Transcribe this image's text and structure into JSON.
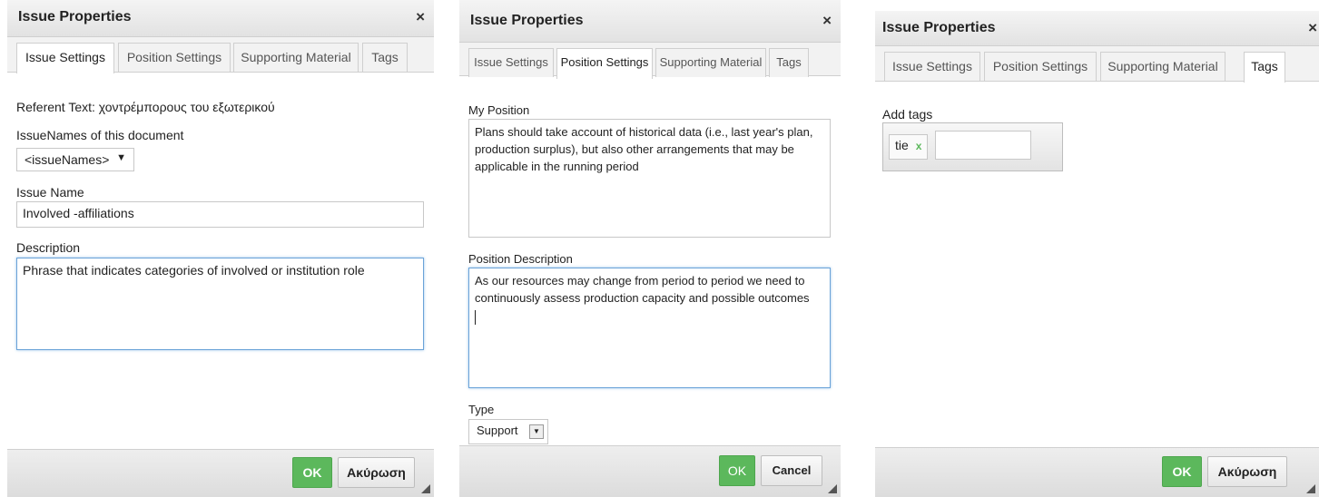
{
  "dialogs": [
    {
      "title": "Issue Properties",
      "close_icon": "×",
      "tabs": [
        "Issue Settings",
        "Position Settings",
        "Supporting Material",
        "Tags"
      ],
      "active_tab": "Issue Settings",
      "referent_text": "Referent Text: χοντρέμπορους του εξωτερικού",
      "issue_names_label": "IssueNames of this document",
      "issue_names_select": "<issueNames>",
      "issue_name_label": "Issue Name",
      "issue_name_value": "Involved -affiliations",
      "description_label": "Description",
      "description_value": "Phrase that indicates categories of involved or institution role",
      "ok_label": "OK",
      "cancel_label": "Ακύρωση"
    },
    {
      "title": "Issue Properties",
      "close_icon": "×",
      "tabs": [
        "Issue Settings",
        "Position Settings",
        "Supporting Material",
        "Tags"
      ],
      "active_tab": "Position Settings",
      "my_position_label": "My Position",
      "my_position_value": "Plans should take account of historical data (i.e., last year's plan, production surplus), but also other arrangements that may be applicable in the running period",
      "position_description_label": "Position Description",
      "position_description_value": "As our resources may change from period to period we need to continuously assess production capacity and possible outcomes",
      "type_label": "Type",
      "type_value": "Support",
      "ok_label": "OK",
      "cancel_label": "Cancel"
    },
    {
      "title": "Issue Properties",
      "close_icon": "×",
      "tabs": [
        "Issue Settings",
        "Position Settings",
        "Supporting Material",
        "Tags"
      ],
      "active_tab": "Tags",
      "add_tags_label": "Add tags",
      "tags": [
        {
          "label": "tie",
          "remove": "x"
        }
      ],
      "ok_label": "OK",
      "cancel_label": "Ακύρωση"
    }
  ],
  "colors": {
    "ok_green": "#5cb85c",
    "focus_blue": "#6aa3d8",
    "tag_remove_green": "#5cb85c"
  }
}
